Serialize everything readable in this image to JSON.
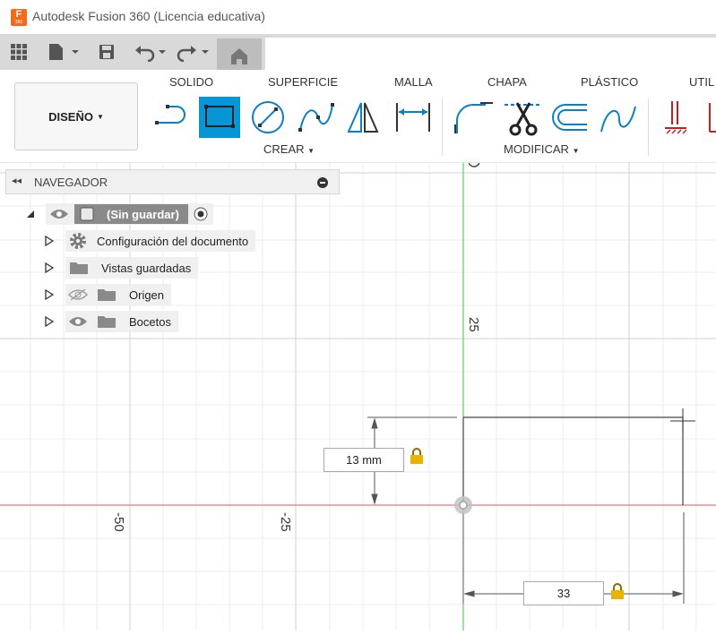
{
  "window": {
    "title": "Autodesk Fusion 360 (Licencia educativa)",
    "logo_letter": "F",
    "logo_sub": "360"
  },
  "workspace_button": "DISEÑO",
  "tabs": [
    "SOLIDO",
    "SUPERFICIE",
    "MALLA",
    "CHAPA",
    "PLÁSTICO",
    "UTIL"
  ],
  "groups": {
    "create": "CREAR",
    "modify": "MODIFICAR"
  },
  "browser": {
    "title": "NAVEGADOR",
    "root": "(Sin guardar)",
    "items": [
      {
        "label": "Configuración del documento",
        "icon": "gear-icon"
      },
      {
        "label": "Vistas guardadas",
        "icon": "folder-icon"
      },
      {
        "label": "Origen",
        "icon": "folder-icon"
      },
      {
        "label": "Bocetos",
        "icon": "folder-icon"
      }
    ]
  },
  "canvas": {
    "axis_labels": {
      "y_25": "25",
      "x_neg50": "-50",
      "x_neg25": "-25"
    },
    "dimensions": {
      "height": "13 mm",
      "width": "33"
    }
  },
  "colors": {
    "accent": "#0696d7",
    "x_axis": "#e05a5a",
    "y_axis": "#3cc83c",
    "lock": "#e8b400"
  }
}
